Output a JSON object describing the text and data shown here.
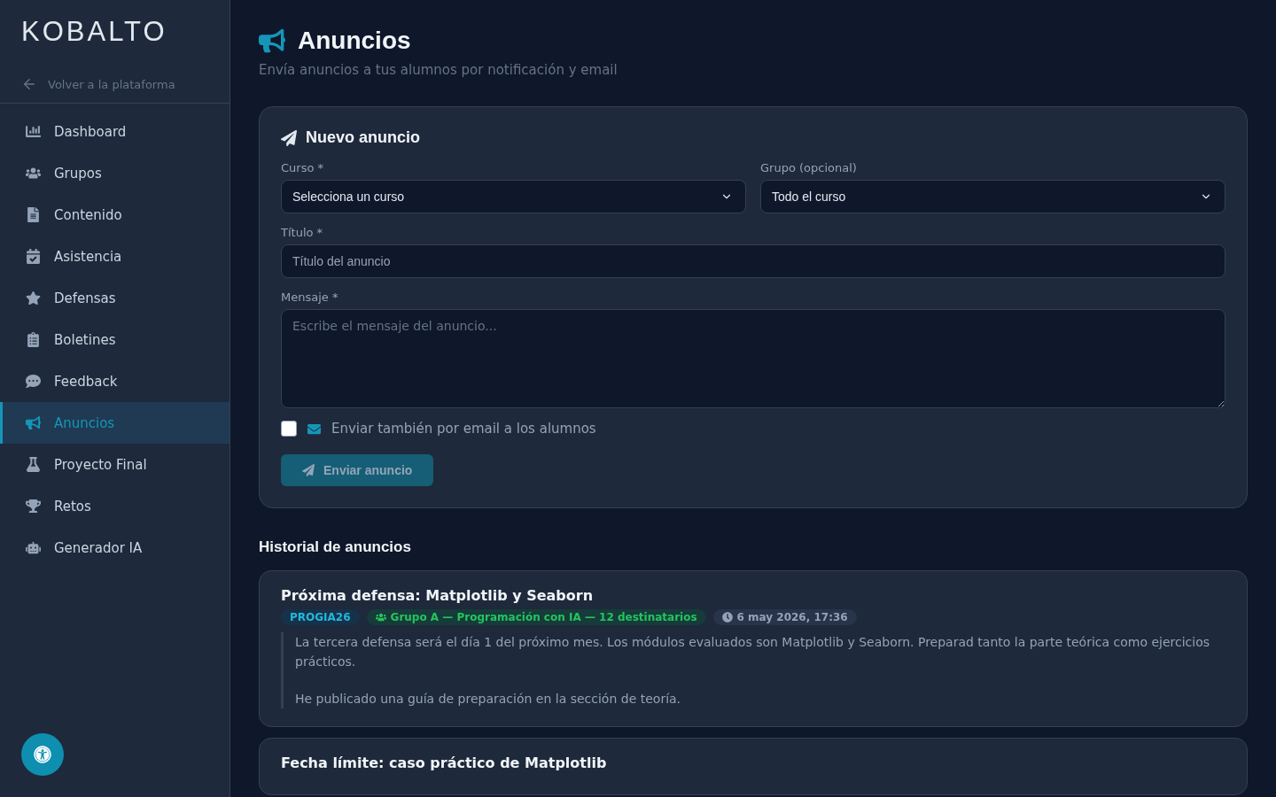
{
  "sidebar": {
    "logo": "KOBALTO",
    "back_link": "Volver a la plataforma",
    "items": [
      {
        "label": "Dashboard",
        "selected": false
      },
      {
        "label": "Grupos",
        "selected": false
      },
      {
        "label": "Contenido",
        "selected": false
      },
      {
        "label": "Asistencia",
        "selected": false
      },
      {
        "label": "Defensas",
        "selected": false
      },
      {
        "label": "Boletines",
        "selected": false
      },
      {
        "label": "Feedback",
        "selected": false
      },
      {
        "label": "Anuncios",
        "selected": true
      },
      {
        "label": "Proyecto Final",
        "selected": false
      },
      {
        "label": "Retos",
        "selected": false
      },
      {
        "label": "Generador IA",
        "selected": false
      }
    ]
  },
  "header": {
    "title": "Anuncios",
    "subtitle": "Envía anuncios a tus alumnos por notificación y email"
  },
  "form": {
    "title": "Nuevo anuncio",
    "course": {
      "label": "Curso *",
      "value": "Selecciona un curso"
    },
    "group": {
      "label": "Grupo (opcional)",
      "value": "Todo el curso"
    },
    "subject": {
      "label": "Título *",
      "placeholder": "Título del anuncio"
    },
    "message": {
      "label": "Mensaje *",
      "placeholder": "Escribe el mensaje del anuncio..."
    },
    "email_option": {
      "label": "Enviar también por email a los alumnos",
      "checked": false
    },
    "submit": {
      "label": "Enviar anuncio",
      "disabled": true
    }
  },
  "history": {
    "title": "Historial de anuncios",
    "items": [
      {
        "title": "Próxima defensa: Matplotlib y Seaborn",
        "course": "PROGIA26",
        "audience": "Grupo A — Programación con IA — 12 destinatarios",
        "date": "6 may 2026, 17:36",
        "paragraphs": [
          "La tercera defensa será el día 1 del próximo mes. Los módulos evaluados son Matplotlib y Seaborn. Preparad tanto la parte teórica como ejercicios prácticos.",
          "He publicado una guía de preparación en la sección de teoría."
        ]
      },
      {
        "title": "Fecha límite: caso práctico de Matplotlib"
      }
    ]
  }
}
